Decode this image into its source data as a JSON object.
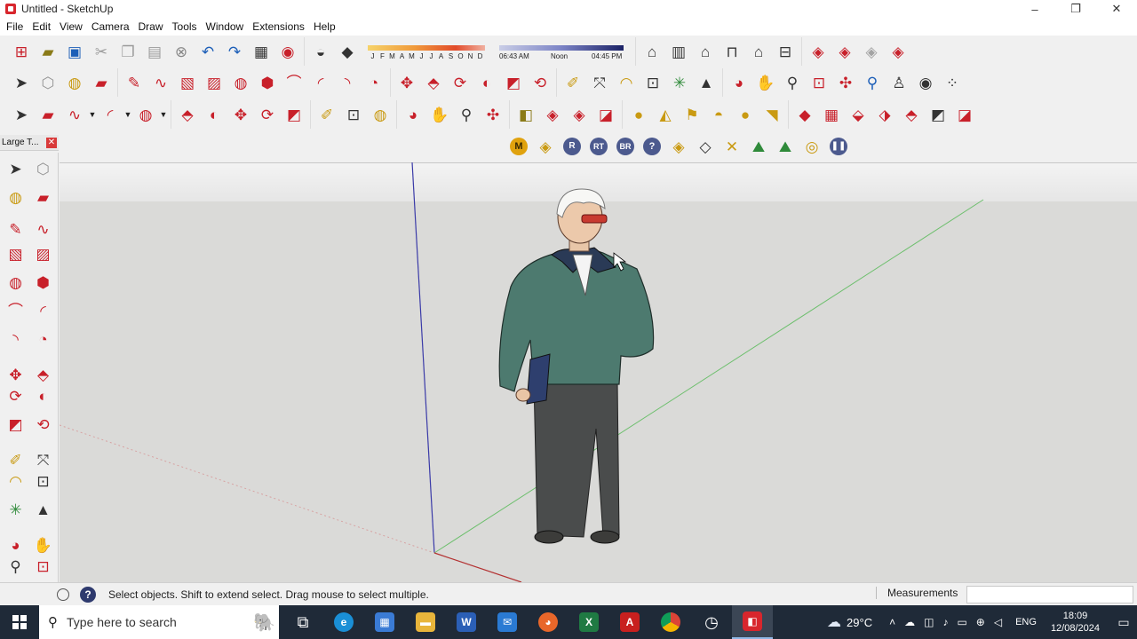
{
  "window": {
    "title": "Untitled - SketchUp",
    "controls": [
      "–",
      "❐",
      "✕"
    ]
  },
  "menu": [
    "File",
    "Edit",
    "View",
    "Camera",
    "Draw",
    "Tools",
    "Window",
    "Extensions",
    "Help"
  ],
  "shadow_settings": {
    "months": [
      "J",
      "F",
      "M",
      "A",
      "M",
      "J",
      "J",
      "A",
      "S",
      "O",
      "N",
      "D"
    ],
    "time_start": "06:43 AM",
    "time_mid": "Noon",
    "time_end": "04:45 PM"
  },
  "toolbars": {
    "row1": [
      "new-model",
      "open",
      "save",
      "cut",
      "copy",
      "paste",
      "erase",
      "undo",
      "redo",
      "print",
      "model-info",
      "section-plane",
      "eraser-fill",
      "warehouse",
      "components",
      "home",
      "shop",
      "house",
      "store",
      "ext1",
      "ext2",
      "ext3",
      "ext4"
    ],
    "row2": [
      "select",
      "make-component",
      "paint-bucket",
      "eraser",
      "line",
      "freehand",
      "rectangle",
      "rotated-rect",
      "circle",
      "polygon",
      "arc",
      "2pt-arc",
      "3pt-arc",
      "pie",
      "move",
      "push-pull",
      "rotate",
      "follow-me",
      "scale",
      "offset",
      "tape-measure",
      "dimension",
      "protractor",
      "text",
      "axes",
      "3d-text",
      "orbit",
      "pan",
      "zoom",
      "zoom-window",
      "zoom-extents",
      "previous",
      "position-camera",
      "look-around",
      "walk"
    ],
    "row3": [
      "select",
      "eraser",
      "freehand",
      "arc",
      "circle",
      "push-pull",
      "follow-me",
      "move",
      "rotate",
      "scale",
      "tape-measure",
      "text",
      "paint-bucket",
      "orbit",
      "pan",
      "zoom",
      "zoom-extents",
      "section",
      "warehouse",
      "components",
      "extension-manager",
      "sandbox1",
      "sandbox2",
      "sandbox3",
      "sandbox4",
      "sandbox5",
      "sandbox6",
      "styles1",
      "styles2",
      "styles3",
      "styles4",
      "styles5",
      "styles6",
      "styles7"
    ],
    "row4_labels": [
      "M",
      "R",
      "RT",
      "BR",
      "?"
    ]
  },
  "large_tool_set": {
    "title": "Large T...",
    "close": "✕"
  },
  "status": {
    "hint": "Select objects. Shift to extend select. Drag mouse to select multiple.",
    "help": "?",
    "measurements_label": "Measurements",
    "measurements_value": ""
  },
  "taskbar": {
    "search_placeholder": "Type here to search",
    "apps": [
      "task-view",
      "edge",
      "store",
      "file-explorer",
      "word",
      "mail",
      "firefox",
      "excel",
      "acrobat",
      "chrome",
      "recorder",
      "sketchup"
    ],
    "app_glyphs": {
      "word": "W",
      "excel": "X",
      "acrobat": "A"
    },
    "weather": "29°C",
    "language": "ENG",
    "time": "18:09",
    "date": "12/08/2024"
  }
}
